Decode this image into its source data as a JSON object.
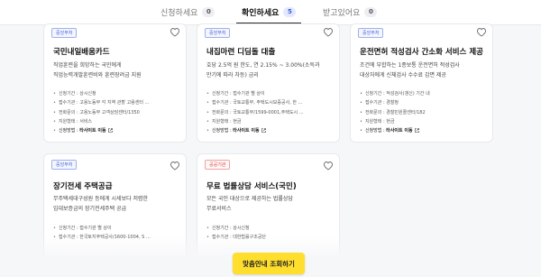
{
  "tabs": [
    {
      "label": "신청하세요",
      "count": "0"
    },
    {
      "label": "확인하세요",
      "count": "5"
    },
    {
      "label": "받고있어요",
      "count": "0"
    }
  ],
  "cards": [
    {
      "badge": "중앙부처",
      "title": "국민내일배움카드",
      "desc": "직업훈련을 희망하는 국민에게\n직업능력개발훈련비와 훈련장려금 지원",
      "info": [
        "신청기간 : 상시신청",
        "접수기관 : 고용노동부 각 지역 관할 고용센터 ...",
        "전화문의 : 고용노동부 고객상담센터/1350",
        "지원형태 : 서비스"
      ],
      "apply_label": "신청방법 :",
      "apply_value": "타사이트 이동"
    },
    {
      "badge": "중앙부처",
      "title": "내집마련 디딤돌 대출",
      "desc": "호당 2.5억 원 한도, 연 2.15% ~ 3.00%(소득과\n만기에 따라 차등) 금리",
      "info": [
        "신청기간 : 접수기관 별 상이",
        "접수기관 : 국토교통부, 주택도시보증공사, 한 ...",
        "전화문의 : 국토교통부/1599-0001,주택도시 ...",
        "지원형태 : 현금"
      ],
      "apply_label": "신청방법 :",
      "apply_value": "타사이트 이동"
    },
    {
      "badge": "중앙부처",
      "title": "운전면허 적성검사 간소화 서비스 제공",
      "desc": "조건에 부합하는 1종보통 운전면허 적성검사\n대상자에게 신체검사 수수료 감면 제공",
      "info": [
        "신청기간 : 적성검사(갱신) 기간 내",
        "접수기관 : 경찰청",
        "전화문의 : 경찰민원콜센터/182",
        "지원형태 : 현금"
      ],
      "apply_label": "신청방법 :",
      "apply_value": "타사이트 이동"
    },
    {
      "badge": "중앙부처",
      "title": "장기전세 주택공급",
      "desc": "무주택세대구성원 등에게 시세보다 저렴한\n임대보증금의 장기전세주택 공급",
      "info": [
        "신청기간 : 접수기관 별 상이",
        "접수기관 : 한국토지주택공사/1600-1004, S ..."
      ],
      "apply_label": "",
      "apply_value": ""
    },
    {
      "badge": "공공기관",
      "title": "무료 법률상담 서비스(국민)",
      "desc": "모든 국민 대상으로 제공하는 법률상담\n무료서비스",
      "info": [
        "신청기간 : 상시신청",
        "접수기관 : 대한법률구조공단"
      ],
      "apply_label": "",
      "apply_value": ""
    }
  ],
  "cta_label": "맞춤안내 조회하기",
  "colors": {
    "accent": "#3d5bd9",
    "cta": "#ffde2e"
  }
}
